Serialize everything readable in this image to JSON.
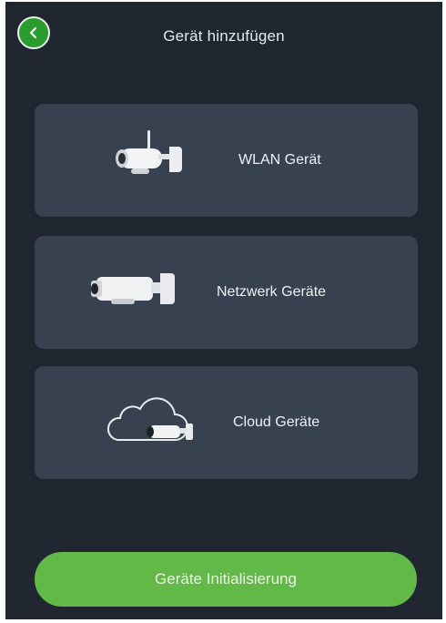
{
  "header": {
    "title": "Gerät hinzufügen",
    "back_icon": "chevron-left-icon"
  },
  "options": [
    {
      "label": "WLAN Gerät",
      "icon": "wifi-bullet-camera-icon"
    },
    {
      "label": "Netzwerk Geräte",
      "icon": "network-bullet-camera-icon"
    },
    {
      "label": "Cloud Geräte",
      "icon": "cloud-camera-icon"
    }
  ],
  "footer": {
    "init_button_label": "Geräte Initialisierung"
  },
  "colors": {
    "background": "#1f2630",
    "card": "#37414f",
    "accent_green": "#63b947",
    "back_button_green": "#2a9d2e"
  }
}
